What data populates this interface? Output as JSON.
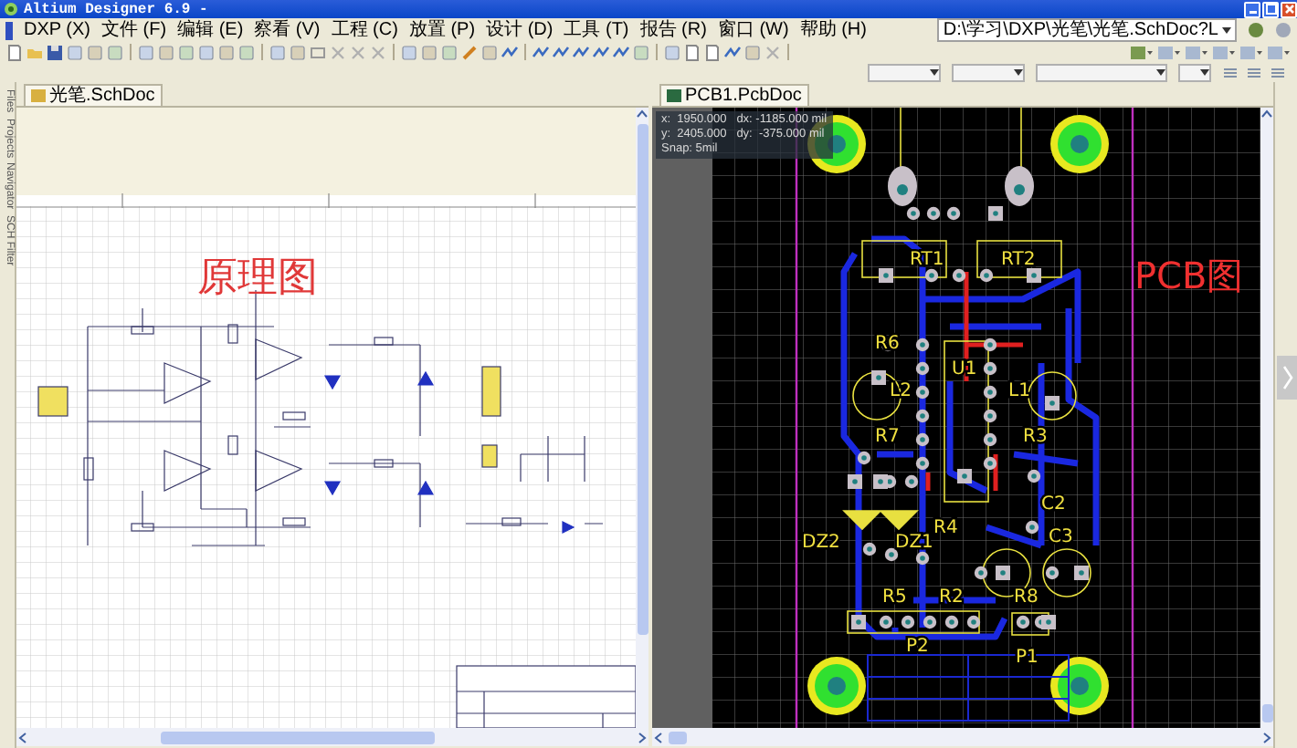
{
  "window": {
    "title": "Altium Designer 6.9 -"
  },
  "menu": [
    "DXP (X)",
    "文件 (F)",
    "编辑 (E)",
    "察看 (V)",
    "工程 (C)",
    "放置 (P)",
    "设计 (D)",
    "工具 (T)",
    "报告 (R)",
    "窗口 (W)",
    "帮助 (H)"
  ],
  "path_field": {
    "value": "D:\\学习\\DXP\\光笔\\光笔.SchDoc?L"
  },
  "side_tabs": [
    "Files",
    "Projects",
    "Navigator",
    "SCH Filter"
  ],
  "schematic": {
    "tab": "光笔.SchDoc",
    "annotation": "原理图"
  },
  "pcb": {
    "tab": "PCB1.PcbDoc",
    "annotation": "PCB图",
    "readout": [
      "x:  1950.000   dx: -1185.000 mil",
      "y:  2405.000   dy:  -375.000 mil",
      "Snap: 5mil"
    ],
    "designators": [
      "RT1",
      "RT2",
      "R6",
      "U1",
      "L2",
      "L1",
      "R7",
      "R3",
      "C2",
      "R4",
      "DZ2",
      "DZ1",
      "C3",
      "R5",
      "R2",
      "R8",
      "P2",
      "P1"
    ]
  }
}
